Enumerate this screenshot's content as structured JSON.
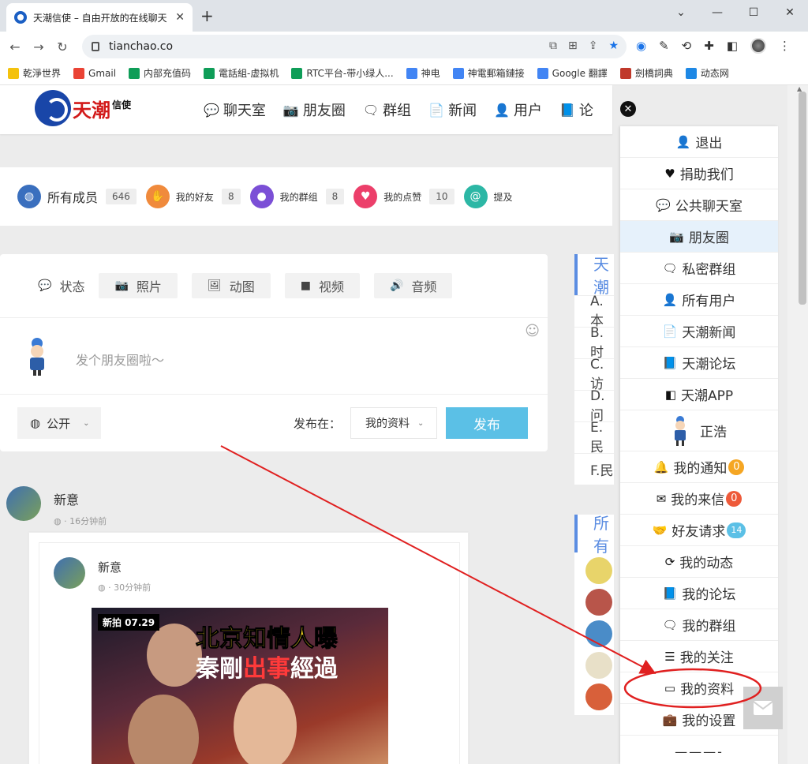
{
  "browser": {
    "tab_title": "天潮信使 – 自由开放的在线聊天",
    "url": "tianchao.co",
    "window_controls": [
      "⌄",
      "—",
      "☐",
      "✕"
    ],
    "bookmarks": [
      {
        "label": "乾淨世界",
        "color": "#f4c20d"
      },
      {
        "label": "Gmail",
        "color": "#ea4335"
      },
      {
        "label": "内部充值码",
        "color": "#0f9d58"
      },
      {
        "label": "電話組-虚拟机",
        "color": "#0f9d58"
      },
      {
        "label": "RTC平台-带小绿人...",
        "color": "#0f9d58"
      },
      {
        "label": "神电",
        "color": "#4285f4"
      },
      {
        "label": "神電郵箱鏈接",
        "color": "#4285f4"
      },
      {
        "label": "Google 翻譯",
        "color": "#4285f4"
      },
      {
        "label": "劍橋詞典",
        "color": "#c0392b"
      },
      {
        "label": "动态网",
        "color": "#1e88e5"
      }
    ]
  },
  "site": {
    "logo_text": "天潮",
    "logo_sub": "信使",
    "nav": [
      {
        "icon": "chat-icon",
        "glyph": "💬",
        "label": "聊天室"
      },
      {
        "icon": "camera-icon",
        "glyph": "📷",
        "label": "朋友圈"
      },
      {
        "icon": "group-chat-icon",
        "glyph": "🗨",
        "label": "群组"
      },
      {
        "icon": "news-icon",
        "glyph": "📄",
        "label": "新闻"
      },
      {
        "icon": "add-user-icon",
        "glyph": "👤",
        "label": "用户"
      },
      {
        "icon": "forum-icon",
        "glyph": "📘",
        "label": "论"
      }
    ]
  },
  "stats": [
    {
      "label": "所有成员",
      "count": "646",
      "color": "#3a6fbe",
      "glyph": "◍",
      "icon": "globe-icon"
    },
    {
      "label": "我的好友",
      "count": "8",
      "color": "#f08a3c",
      "glyph": "✋",
      "icon": "handshake-icon"
    },
    {
      "label": "我的群组",
      "count": "8",
      "color": "#7b4fd6",
      "glyph": "●",
      "icon": "users-icon"
    },
    {
      "label": "我的点赞",
      "count": "10",
      "color": "#ec3f6a",
      "glyph": "♥",
      "icon": "heart-icon"
    },
    {
      "label": "提及",
      "count": "",
      "color": "#2cb7a5",
      "glyph": "@",
      "icon": "at-icon"
    }
  ],
  "composer": {
    "tabs": [
      {
        "label": "状态",
        "icon": "status-icon",
        "glyph": "💬"
      },
      {
        "label": "照片",
        "icon": "photo-icon",
        "glyph": "📷"
      },
      {
        "label": "动图",
        "icon": "gif-icon",
        "glyph": "🖼"
      },
      {
        "label": "视频",
        "icon": "video-icon",
        "glyph": "■"
      },
      {
        "label": "音频",
        "icon": "audio-icon",
        "glyph": "🔊"
      }
    ],
    "placeholder": "发个朋友圈啦～",
    "privacy": "公开",
    "publish_at_label": "发布在：",
    "target": "我的资料",
    "publish_button": "发布"
  },
  "sidebar": {
    "widget1_title": "天潮",
    "widget1_rows": [
      "A.本",
      "B.时",
      "C.访",
      "D.问",
      "E.民",
      "F.民"
    ],
    "widget2_title": "所有"
  },
  "feed": {
    "author": "新意",
    "time": "16分钟前",
    "shared_author": "新意",
    "shared_time": "30分钟前",
    "thumb_badge": "新拍 07.29",
    "thumb_line1": "北京知情人曝",
    "thumb_line2_a": "秦剛",
    "thumb_line2_b": "出事",
    "thumb_line2_c": "經過"
  },
  "menu": {
    "items": [
      {
        "label": "退出",
        "icon": "user-icon",
        "glyph": "👤"
      },
      {
        "label": "捐助我们",
        "icon": "heart-icon",
        "glyph": "♥"
      },
      {
        "label": "公共聊天室",
        "icon": "chat-icon",
        "glyph": "💬"
      },
      {
        "label": "朋友圈",
        "icon": "camera-icon",
        "glyph": "📷",
        "active": true
      },
      {
        "label": "私密群组",
        "icon": "group-chat-icon",
        "glyph": "🗨"
      },
      {
        "label": "所有用户",
        "icon": "add-user-icon",
        "glyph": "👤"
      },
      {
        "label": "天潮新闻",
        "icon": "news-icon",
        "glyph": "📄"
      },
      {
        "label": "天潮论坛",
        "icon": "forum-icon",
        "glyph": "📘"
      },
      {
        "label": "天潮APP",
        "icon": "app-icon",
        "glyph": "◧"
      }
    ],
    "user_name": "正浩",
    "user_items": [
      {
        "label": "我的通知",
        "icon": "bell-icon",
        "glyph": "🔔",
        "badge": "0",
        "badge_color": "#f5a623"
      },
      {
        "label": "我的来信",
        "icon": "envelope-icon",
        "glyph": "✉",
        "badge": "0",
        "badge_color": "#ee5a3a"
      },
      {
        "label": "好友请求",
        "icon": "handshake-icon",
        "glyph": "🤝",
        "badge": "14",
        "badge_color": "#5bc0e6"
      },
      {
        "label": "我的动态",
        "icon": "refresh-icon",
        "glyph": "⟳"
      },
      {
        "label": "我的论坛",
        "icon": "forum-icon",
        "glyph": "📘"
      },
      {
        "label": "我的群组",
        "icon": "group-chat-icon",
        "glyph": "🗨"
      },
      {
        "label": "我的关注",
        "icon": "rss-icon",
        "glyph": "☰"
      },
      {
        "label": "我的资料",
        "icon": "id-card-icon",
        "glyph": "▭"
      },
      {
        "label": "我的设置",
        "icon": "briefcase-icon",
        "glyph": "💼"
      }
    ],
    "more": "———-"
  },
  "annotation": {
    "color": "#e02020"
  }
}
